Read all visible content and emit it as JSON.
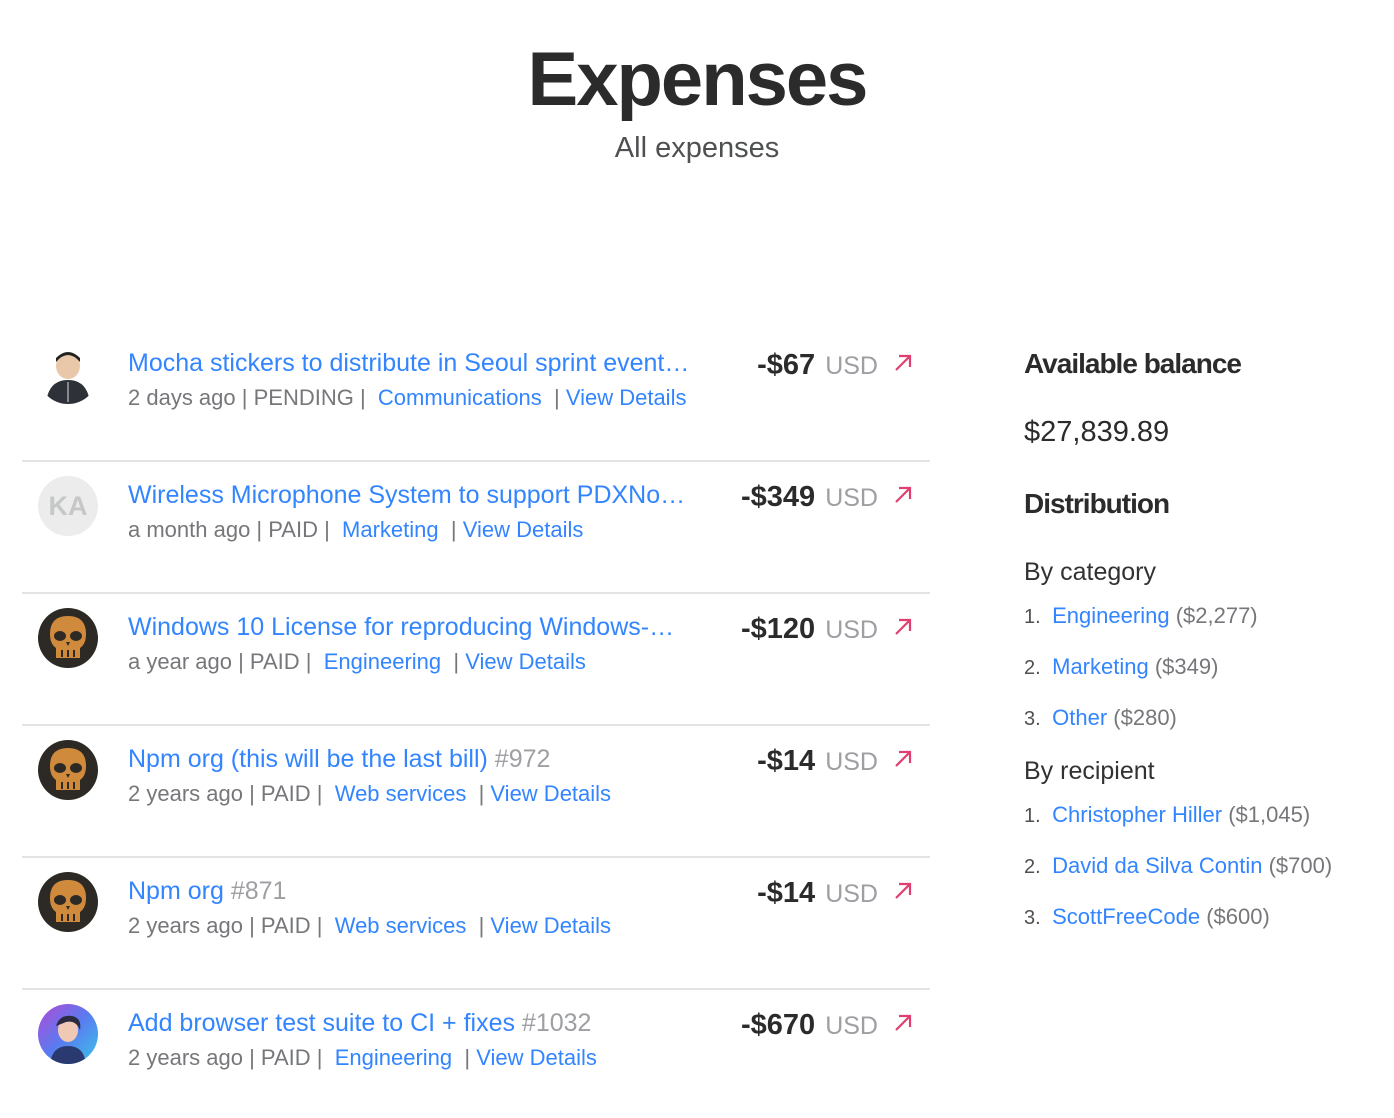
{
  "header": {
    "title": "Expenses",
    "subtitle": "All expenses"
  },
  "expenses": [
    {
      "title": "Mocha stickers to distribute in Seoul sprint event…",
      "number": "",
      "time": "2 days ago",
      "status": "PENDING",
      "category": "Communications",
      "details_label": "View Details",
      "amount": "-$67",
      "currency": "USD",
      "avatar": "user-photo-avatar"
    },
    {
      "title": "Wireless Microphone System to support PDXNo…",
      "number": "",
      "time": "a month ago",
      "status": "PAID",
      "category": "Marketing",
      "details_label": "View Details",
      "amount": "-$349",
      "currency": "USD",
      "avatar_initials": "KA"
    },
    {
      "title": "Windows 10 License for reproducing Windows-…",
      "number": "",
      "time": "a year ago",
      "status": "PAID",
      "category": "Engineering",
      "details_label": "View Details",
      "amount": "-$120",
      "currency": "USD",
      "avatar": "skull-avatar"
    },
    {
      "title": "Npm org (this will be the last bill)",
      "number": "#972",
      "time": "2 years ago",
      "status": "PAID",
      "category": "Web services",
      "details_label": "View Details",
      "amount": "-$14",
      "currency": "USD",
      "avatar": "skull-avatar"
    },
    {
      "title": "Npm org",
      "number": "#871",
      "time": "2 years ago",
      "status": "PAID",
      "category": "Web services",
      "details_label": "View Details",
      "amount": "-$14",
      "currency": "USD",
      "avatar": "skull-avatar"
    },
    {
      "title": "Add browser test suite to CI + fixes",
      "number": "#1032",
      "time": "2 years ago",
      "status": "PAID",
      "category": "Engineering",
      "details_label": "View Details",
      "amount": "-$670",
      "currency": "USD",
      "avatar": "gradient-photo-avatar"
    }
  ],
  "sidebar": {
    "balance_heading": "Available balance",
    "balance": "$27,839.89",
    "distribution_heading": "Distribution",
    "by_category_heading": "By category",
    "by_category": [
      {
        "index": "1.",
        "name": "Engineering",
        "amount": "($2,277)"
      },
      {
        "index": "2.",
        "name": "Marketing",
        "amount": "($349)"
      },
      {
        "index": "3.",
        "name": "Other",
        "amount": "($280)"
      }
    ],
    "by_recipient_heading": "By recipient",
    "by_recipient": [
      {
        "index": "1.",
        "name": "Christopher Hiller",
        "amount": "($1,045)"
      },
      {
        "index": "2.",
        "name": "David da Silva Contin",
        "amount": "($700)"
      },
      {
        "index": "3.",
        "name": "ScottFreeCode",
        "amount": "($600)"
      }
    ]
  },
  "colors": {
    "link": "#3385ff",
    "arrow": "#e03f6f",
    "muted": "#76777a"
  }
}
